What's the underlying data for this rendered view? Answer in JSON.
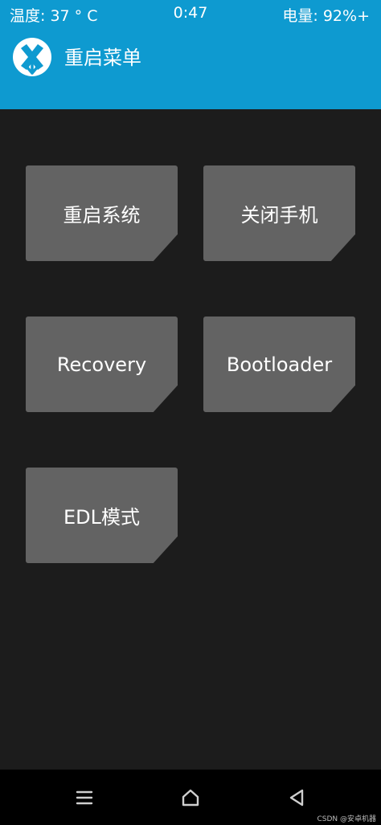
{
  "status_bar": {
    "temperature": "温度: 37 ° C",
    "time": "0:47",
    "battery": "电量: 92%+"
  },
  "header": {
    "title": "重启菜单"
  },
  "buttons": {
    "reboot_system": "重启系统",
    "power_off": "关闭手机",
    "recovery": "Recovery",
    "bootloader": "Bootloader",
    "edl_mode": "EDL模式"
  },
  "nav_bar": {
    "icons": [
      "menu-icon",
      "home-icon",
      "back-icon"
    ]
  },
  "watermark": "CSDN @安卓机器",
  "colors": {
    "header_blue": "#0e9ad0",
    "background": "#1c1c1c",
    "tile": "#636363",
    "nav_bar": "#000000"
  }
}
